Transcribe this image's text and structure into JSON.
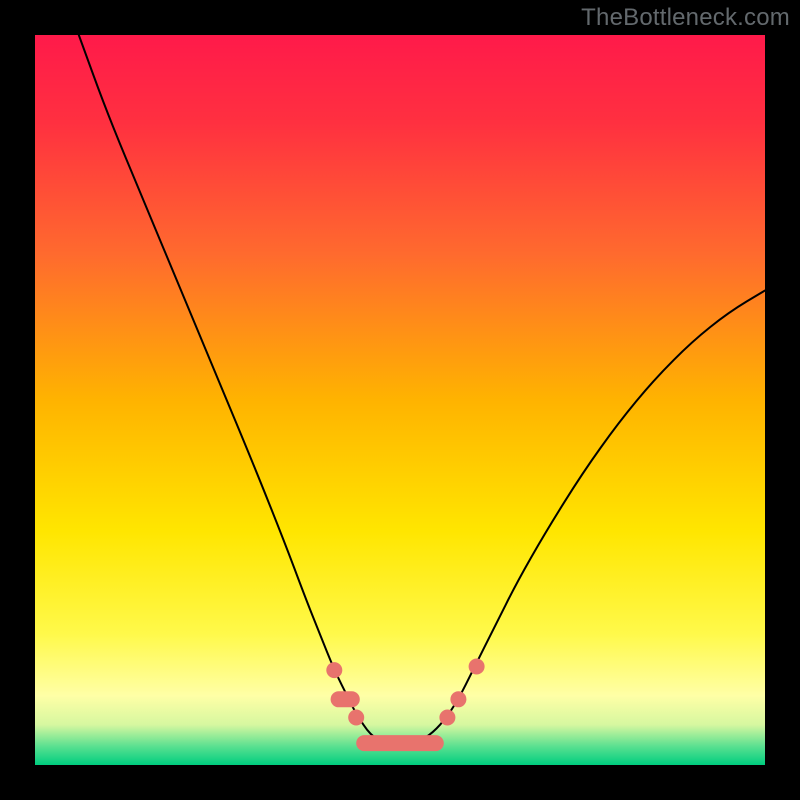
{
  "watermark": "TheBottleneck.com",
  "colors": {
    "frame": "#000000",
    "curve": "#000000",
    "marker": "#e8736d",
    "gradient_stops": [
      {
        "offset": 0.0,
        "color": "#ff1a4a"
      },
      {
        "offset": 0.12,
        "color": "#ff3040"
      },
      {
        "offset": 0.3,
        "color": "#ff6a2e"
      },
      {
        "offset": 0.5,
        "color": "#ffb300"
      },
      {
        "offset": 0.68,
        "color": "#ffe600"
      },
      {
        "offset": 0.82,
        "color": "#fff94a"
      },
      {
        "offset": 0.905,
        "color": "#ffffa6"
      },
      {
        "offset": 0.945,
        "color": "#d6f7a0"
      },
      {
        "offset": 0.975,
        "color": "#58e090"
      },
      {
        "offset": 1.0,
        "color": "#00cd7f"
      }
    ]
  },
  "chart_data": {
    "type": "line",
    "title": "",
    "xlabel": "",
    "ylabel": "",
    "xlim": [
      0,
      100
    ],
    "ylim": [
      0,
      100
    ],
    "series": [
      {
        "name": "curve",
        "x": [
          6,
          10,
          15,
          20,
          25,
          30,
          34,
          37,
          39,
          41,
          43,
          44,
          46,
          48,
          50,
          52,
          54,
          56,
          58,
          60,
          63,
          66,
          70,
          75,
          80,
          85,
          90,
          95,
          100
        ],
        "y": [
          100,
          89,
          77,
          65,
          53,
          41,
          31,
          23,
          18,
          13,
          9,
          7,
          4,
          3,
          2.5,
          3,
          4,
          6,
          9,
          13,
          19,
          25,
          32,
          40,
          47,
          53,
          58,
          62,
          65
        ]
      }
    ],
    "markers": [
      {
        "kind": "dot",
        "x": 41.0,
        "y": 13.0
      },
      {
        "kind": "pill",
        "x": 42.5,
        "y": 9.0,
        "len": 4
      },
      {
        "kind": "dot",
        "x": 44.0,
        "y": 6.5
      },
      {
        "kind": "pill",
        "x": 50.0,
        "y": 3.0,
        "len": 12
      },
      {
        "kind": "dot",
        "x": 56.5,
        "y": 6.5
      },
      {
        "kind": "dot",
        "x": 58.0,
        "y": 9.0
      },
      {
        "kind": "dot",
        "x": 60.5,
        "y": 13.5
      }
    ]
  }
}
